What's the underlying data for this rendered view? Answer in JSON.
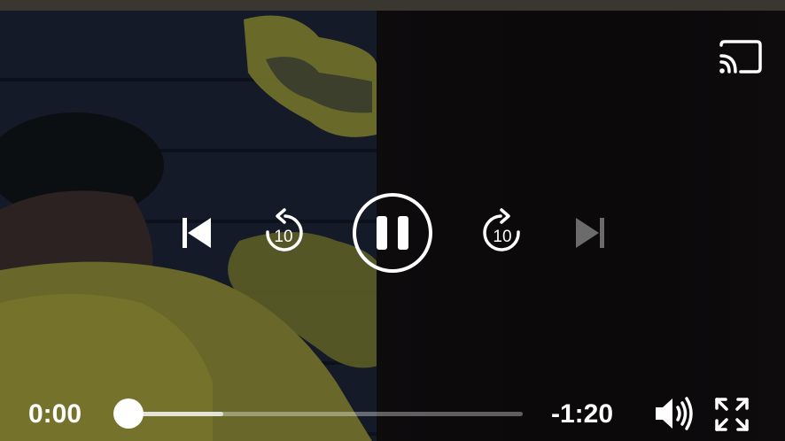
{
  "player": {
    "elapsed": "0:00",
    "remaining": "-1:20",
    "progress": 0.0,
    "buffered": 0.24,
    "state": "playing",
    "skip_seconds": "10"
  },
  "icons": {
    "cast": "cast-icon",
    "previous": "skip-previous-icon",
    "rewind": "replay-10-icon",
    "pause": "pause-icon",
    "forward": "forward-10-icon",
    "next": "skip-next-icon",
    "volume": "volume-icon",
    "fullscreen": "fullscreen-icon"
  },
  "colors": {
    "foreground": "#ffffff",
    "disabled": "#6b6b6b",
    "track": "#8a8a8a"
  }
}
